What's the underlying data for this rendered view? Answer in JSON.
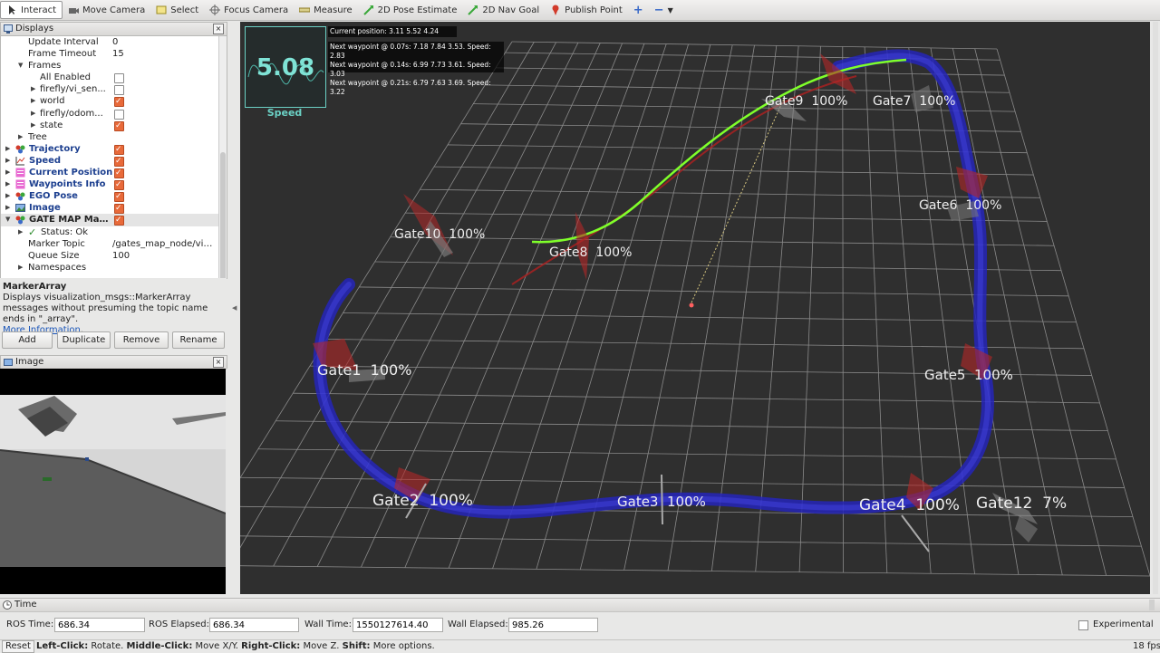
{
  "toolbar": {
    "interact": "Interact",
    "move_camera": "Move Camera",
    "select": "Select",
    "focus_camera": "Focus Camera",
    "measure": "Measure",
    "pose_estimate": "2D Pose Estimate",
    "nav_goal": "2D Nav Goal",
    "publish_point": "Publish Point",
    "plus": "+",
    "minus": "−"
  },
  "displays": {
    "title": "Displays",
    "rows": [
      {
        "name": "Update Interval",
        "value": "0"
      },
      {
        "name": "Frame Timeout",
        "value": "15"
      },
      {
        "name": "Frames"
      },
      {
        "name": "All Enabled"
      },
      {
        "name": "firefly/vi_sen..."
      },
      {
        "name": "world"
      },
      {
        "name": "firefly/odom..."
      },
      {
        "name": "state"
      },
      {
        "name": "Tree"
      },
      {
        "name": "Trajectory"
      },
      {
        "name": "Speed"
      },
      {
        "name": "Current Position"
      },
      {
        "name": "Waypoints Info"
      },
      {
        "name": "EGO Pose"
      },
      {
        "name": "Image"
      },
      {
        "name": "GATE MAP Mar..."
      },
      {
        "name": "Status: Ok"
      },
      {
        "name": "Marker Topic",
        "value": "/gates_map_node/vis..."
      },
      {
        "name": "Queue Size",
        "value": "100"
      },
      {
        "name": "Namespaces"
      }
    ]
  },
  "description": {
    "title": "MarkerArray",
    "text": "Displays visualization_msgs::MarkerArray messages without presuming the topic name ends in \"_array\".",
    "link": "More Information",
    "period": "."
  },
  "buttons": {
    "add": "Add",
    "duplicate": "Duplicate",
    "remove": "Remove",
    "rename": "Rename"
  },
  "image_panel": {
    "title": "Image"
  },
  "overlay": {
    "speed_value": "5.08",
    "speed_label": "Speed",
    "current_position": "Current position: 3.11 5.52 4.24",
    "waypoints": [
      "Next waypoint @ 0.07s: 7.18 7.84 3.53. Speed: 2.83",
      "Next waypoint @ 0.14s: 6.99 7.73 3.61. Speed: 3.03",
      "Next waypoint @ 0.21s: 6.79 7.63 3.69. Speed: 3.22"
    ]
  },
  "gates": [
    {
      "label": "Gate9",
      "pct": "100%"
    },
    {
      "label": "Gate7",
      "pct": "100%"
    },
    {
      "label": "Gate10",
      "pct": "100%"
    },
    {
      "label": "Gate8",
      "pct": "100%"
    },
    {
      "label": "Gate6",
      "pct": "100%"
    },
    {
      "label": "Gate1",
      "pct": "100%"
    },
    {
      "label": "Gate5",
      "pct": "100%"
    },
    {
      "label": "Gate2",
      "pct": "100%"
    },
    {
      "label": "Gate3",
      "pct": "100%"
    },
    {
      "label": "Gate4",
      "pct": "100%"
    },
    {
      "label": "Gate12",
      "pct": "7%"
    }
  ],
  "time": {
    "title": "Time",
    "ros_time_label": "ROS Time:",
    "ros_time": "686.34",
    "ros_elapsed_label": "ROS Elapsed:",
    "ros_elapsed": "686.34",
    "wall_time_label": "Wall Time:",
    "wall_time": "1550127614.40",
    "wall_elapsed_label": "Wall Elapsed:",
    "wall_elapsed": "985.26",
    "experimental": "Experimental"
  },
  "status": {
    "reset": "Reset",
    "left_click": "Left-Click:",
    "left_text": " Rotate. ",
    "middle_click": "Middle-Click:",
    "middle_text": " Move X/Y. ",
    "right_click": "Right-Click:",
    "right_text": " Move Z. ",
    "shift": "Shift:",
    "shift_text": " More options.",
    "fps": "18 fps"
  },
  "colors": {
    "track": "#2a2ad0",
    "trajectory": "#7fff2a",
    "gate": "#c83232",
    "accent": "#6bd1c5"
  }
}
